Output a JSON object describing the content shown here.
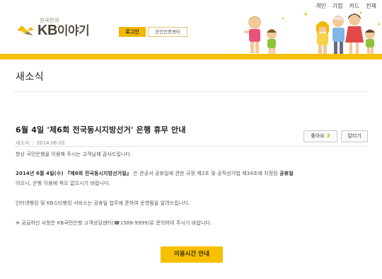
{
  "header": {
    "util_nav": [
      "개인",
      "기업",
      "카드",
      "전체"
    ],
    "brand_sub": "전국민의",
    "logo_prefix": "KB",
    "logo_suffix": "이야기",
    "login_label": "로그인",
    "cert_label": "공인인증센터",
    "accent_color": "#f6c000"
  },
  "section": {
    "title": "새소식"
  },
  "article": {
    "title": "6월 4일 '제6회 전국동시지방선거' 은행 휴무 안내",
    "author": "새소식",
    "date": "2014.06.02",
    "like_label": "좋아요",
    "like_count": "3",
    "share_label": "알리기",
    "p1": "항상 국민은행을 이용해 주시는 고객님께 감사드립니다.",
    "p2_bold": "2014년 6월 4일(수) 『제6회 전국동시지방선거일』",
    "p2_rest": "은 관공서 공휴일에 관한 규정 제2조 및 공직선거법 제34조에 지정된",
    "p2_bold2": "공휴일",
    "p2_line2": "이오니, 은행 이용에 착오 없으시기 바랍니다.",
    "p3": "인터넷뱅킹 및 KB스타뱅킹 서비스는 공휴일 업무에 준하여 운영됨을 알려드립니다.",
    "p4": "※ 궁금하신 사항은 KB국민은행 고객상담센터(☎1588-9999)로 문의하여 주시기 바랍니다.",
    "button_label": "이용시간 안내"
  }
}
